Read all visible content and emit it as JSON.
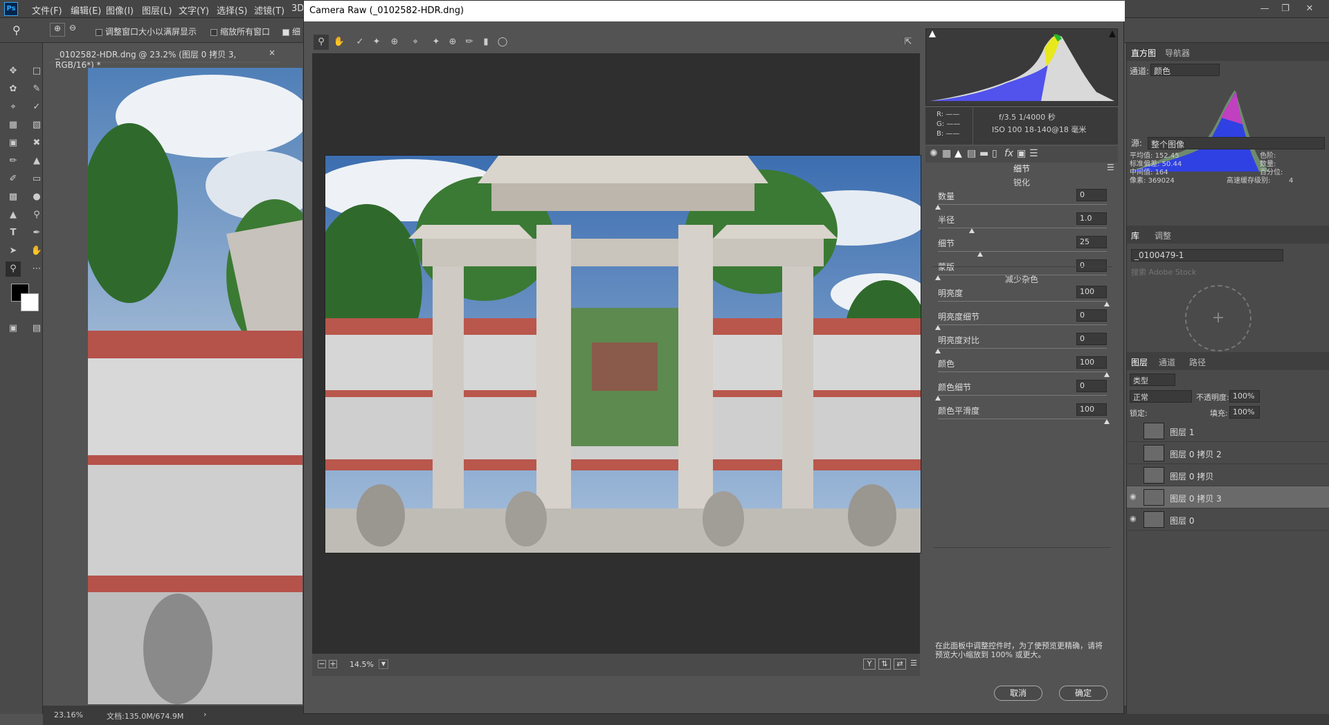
{
  "menubar": {
    "logo": "Ps",
    "items": [
      "文件(F)",
      "编辑(E)",
      "图像(I)",
      "图层(L)",
      "文字(Y)",
      "选择(S)",
      "滤镜(T)",
      "3D"
    ],
    "window_controls": [
      "—",
      "❐",
      "✕"
    ]
  },
  "options": {
    "fit_window": "调整窗口大小以满屏显示",
    "zoom_all": "缩放所有窗口",
    "fine": "细"
  },
  "document": {
    "tab_title": "_0102582-HDR.dng @ 23.2% (图层 0 拷贝 3, RGB/16*) *",
    "close": "×"
  },
  "status": {
    "zoom": "23.16%",
    "doc": "文档:135.0M/674.9M",
    "arrow": "›"
  },
  "dialog": {
    "title": "Camera Raw (_0102582-HDR.dng)",
    "zoom_level": "14.5%",
    "zoom_minus": "−",
    "zoom_plus": "+",
    "view_y": "Y",
    "cancel": "取消",
    "ok": "确定",
    "note": "在此面板中调整控件时，为了使预览更精确，请将预览大小缩放到 100% 或更大。"
  },
  "rgb": {
    "r_label": "R:",
    "g_label": "G:",
    "b_label": "B:",
    "r": "——",
    "g": "——",
    "b": "——"
  },
  "exif": {
    "line1": "f/3.5  1/4000 秒",
    "line2": "ISO 100  18-140@18 毫米"
  },
  "detail_panel": {
    "title": "细节",
    "sharpen_title": "锐化",
    "noise_title": "减少杂色",
    "sharpen": [
      {
        "label": "数量",
        "value": "0",
        "pos": 0
      },
      {
        "label": "半径",
        "value": "1.0",
        "pos": 0.2
      },
      {
        "label": "细节",
        "value": "25",
        "pos": 0.25
      },
      {
        "label": "蒙版",
        "value": "0",
        "pos": 0
      }
    ],
    "noise": [
      {
        "label": "明亮度",
        "value": "100",
        "pos": 1
      },
      {
        "label": "明亮度细节",
        "value": "0",
        "pos": 0
      },
      {
        "label": "明亮度对比",
        "value": "0",
        "pos": 0
      },
      {
        "label": "颜色",
        "value": "100",
        "pos": 1
      },
      {
        "label": "颜色细节",
        "value": "0",
        "pos": 0
      },
      {
        "label": "颜色平滑度",
        "value": "100",
        "pos": 1
      }
    ]
  },
  "histogram_panel": {
    "tab1": "直方图",
    "tab2": "导航器",
    "channel_label": "通道:",
    "channel_value": "颜色",
    "source_label": "源:",
    "source_value": "整个图像",
    "stats": {
      "mean_label": "平均值:",
      "mean": "152.45",
      "std_label": "标准偏差:",
      "std": "50.44",
      "median_label": "中间值:",
      "median": "164",
      "pixels_label": "像素:",
      "pixels": "369024",
      "level_label": "色阶:",
      "count_label": "数量:",
      "pct_label": "百分位:",
      "cache_label": "高速缓存级别:",
      "cache": "4"
    }
  },
  "library": {
    "tab1": "库",
    "tab2": "调整",
    "lib_name": "_0100479-1",
    "search_placeholder": "搜索 Adobe Stock",
    "plus": "+"
  },
  "layers_panel": {
    "tab1": "图层",
    "tab2": "通道",
    "tab3": "路径",
    "filter": "类型",
    "blend": "正常",
    "opacity_label": "不透明度:",
    "opacity": "100%",
    "lock_label": "锁定:",
    "fill_label": "填充:",
    "fill": "100%",
    "layers": [
      {
        "name": "图层 1",
        "visible": false,
        "selected": false
      },
      {
        "name": "图层 0 拷贝 2",
        "visible": false,
        "selected": false
      },
      {
        "name": "图层 0 拷贝",
        "visible": false,
        "selected": false
      },
      {
        "name": "图层 0 拷贝 3",
        "visible": true,
        "selected": true
      },
      {
        "name": "图层 0",
        "visible": true,
        "selected": false
      }
    ]
  },
  "colors": {
    "accent": "#31a8ff",
    "panel": "#535353",
    "dark": "#2f2f2f"
  }
}
